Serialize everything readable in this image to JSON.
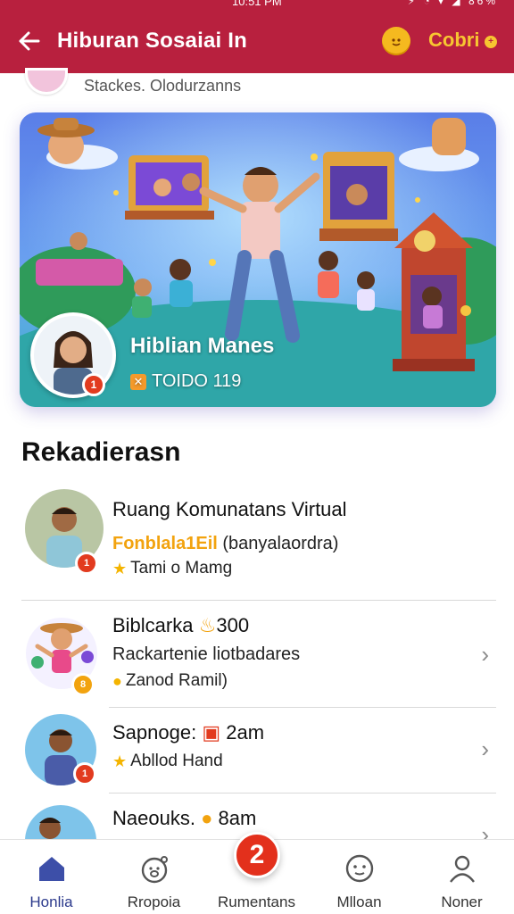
{
  "status": {
    "time": "10:51 PM",
    "icons": "⚡ ◔ ▾ ◢ 86%"
  },
  "app_bar": {
    "title": "Hiburan Sosaiai In",
    "coin_label": "Cobri",
    "coin_dot": "+"
  },
  "sub_header": {
    "text": "Stackes. Olodurzanns"
  },
  "hero": {
    "title": "Hiblian Manes",
    "meta": "TOIDO 119",
    "badge": "1"
  },
  "section_title": "Rekadierasn",
  "list": [
    {
      "title": "Ruang Komunatans Virtual",
      "line_highlight": "Fonblala1Eil",
      "line_rest": "(banyalaordra)",
      "meta": "Tami o Mamg",
      "badge": "1",
      "meta_icon": "star"
    },
    {
      "title": "Biblcarka",
      "title_suffix": "300",
      "line": "Rackartenie liotbadares",
      "meta": "Zanod Ramil)",
      "badge": "8",
      "meta_icon": "coin"
    },
    {
      "title": "Sapnoge:",
      "title_suffix": "2am",
      "meta": "Abllod Hand",
      "badge": "1",
      "meta_icon": "star"
    },
    {
      "title": "Naeouks.",
      "title_suffix": "8am",
      "badge": "",
      "meta_icon": ""
    }
  ],
  "bottom_nav": [
    {
      "label": "Honlia",
      "icon": "home-icon",
      "active": true
    },
    {
      "label": "Rropoia",
      "icon": "pig-icon",
      "active": false
    },
    {
      "label": "Rumentans",
      "icon": "center-fab",
      "active": false
    },
    {
      "label": "Mlloan",
      "icon": "face-icon",
      "active": false
    },
    {
      "label": "Noner",
      "icon": "user-icon",
      "active": false
    }
  ],
  "center_fab_label": "2",
  "colors": {
    "primary": "#b8203e",
    "accent": "#f2a30f",
    "badge": "#e23b1f",
    "nav_active": "#2c3a8c"
  }
}
